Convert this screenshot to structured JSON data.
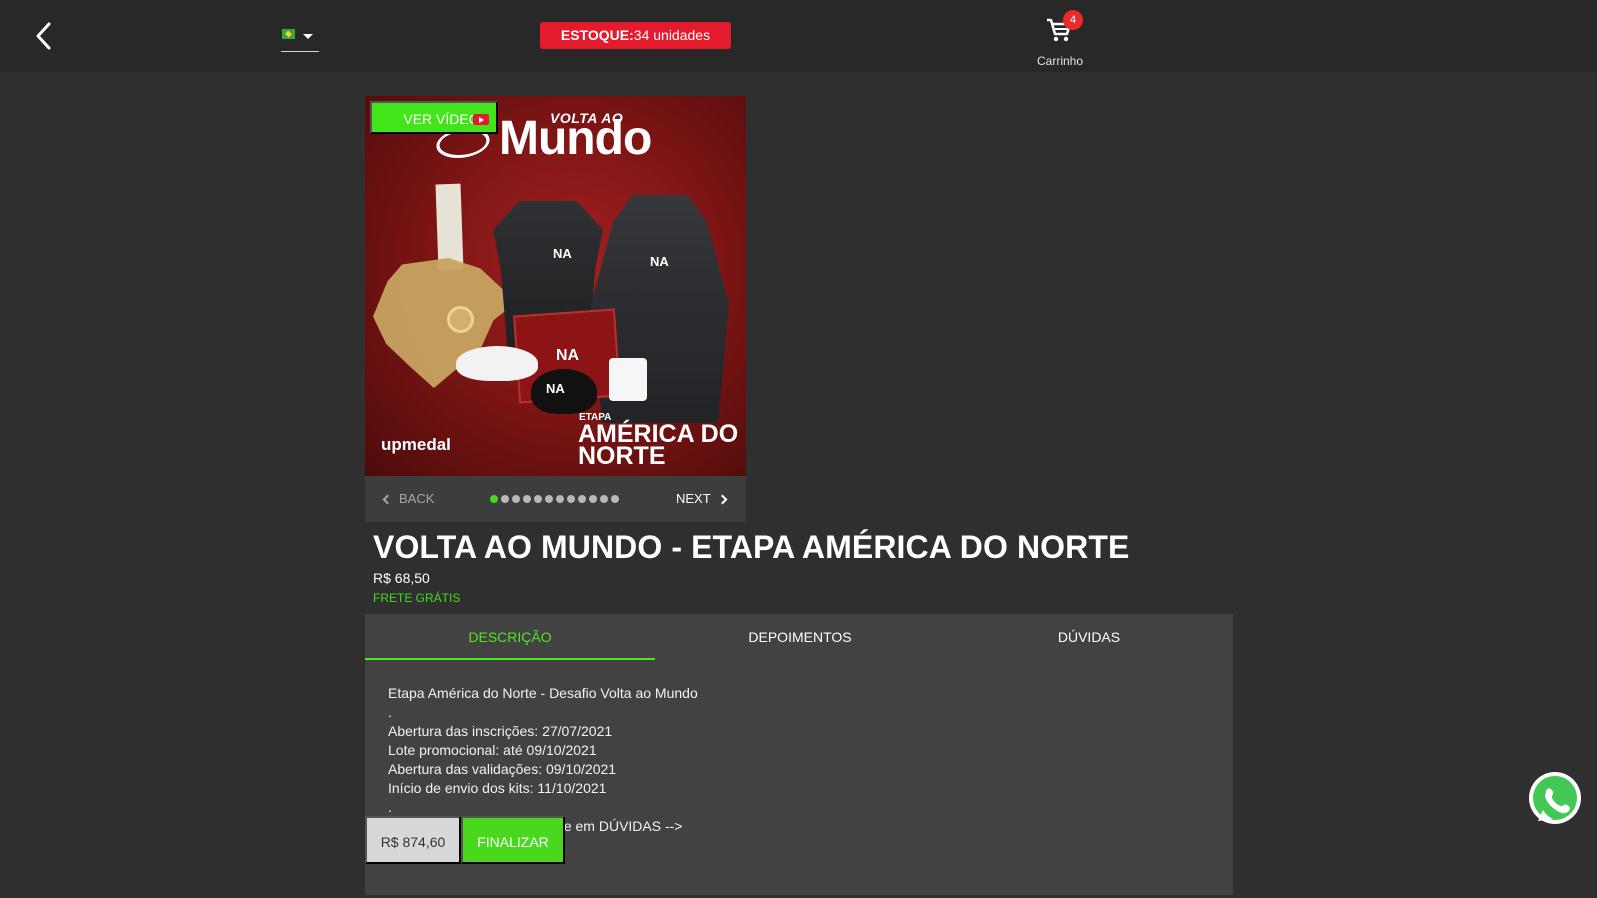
{
  "header": {
    "stock_label": "ESTOQUE:",
    "stock_value": "34 unidades",
    "cart_count": "4",
    "cart_label": "Carrinho"
  },
  "product": {
    "video_button": "VER VÍDEO",
    "image_text": {
      "brand_top": "VOLTA AO",
      "brand_main": "Mundo",
      "stage_prefix": "ETAPA",
      "stage_title": "AMÉRICA DO NORTE",
      "maker": "upmedal",
      "na_mark": "NA"
    },
    "carousel": {
      "back": "BACK",
      "next": "NEXT",
      "dots_count": 12,
      "active_dot": 1
    },
    "title": "VOLTA AO MUNDO - ETAPA AMÉRICA DO NORTE",
    "price": "R$ 68,50",
    "shipping": "FRETE GRÁTIS"
  },
  "tabs": [
    {
      "label": "DESCRIÇÃO",
      "active": true
    },
    {
      "label": "DEPOIMENTOS",
      "active": false
    },
    {
      "label": "DÚVIDAS",
      "active": false
    }
  ],
  "description": [
    "Etapa América do Norte - Desafio Volta ao Mundo",
    ".",
    "Abertura das inscrições: 27/07/2021",
    "Lote promocional: até 09/10/2021",
    "Abertura das validações: 09/10/2021",
    "Início de envio dos kits: 11/10/2021",
    ".",
    "",
    "Para mais informações clique em DÚVIDAS -->"
  ],
  "checkout": {
    "total": "R$ 874,60",
    "button": "FINALIZAR"
  },
  "colors": {
    "accent_green": "#46dc1f",
    "stock_red": "#e31b2d",
    "background": "#2f2f2f"
  },
  "icons": {
    "back": "arrow-left-icon",
    "cart": "shopping-cart-icon",
    "whatsapp": "whatsapp-icon"
  }
}
